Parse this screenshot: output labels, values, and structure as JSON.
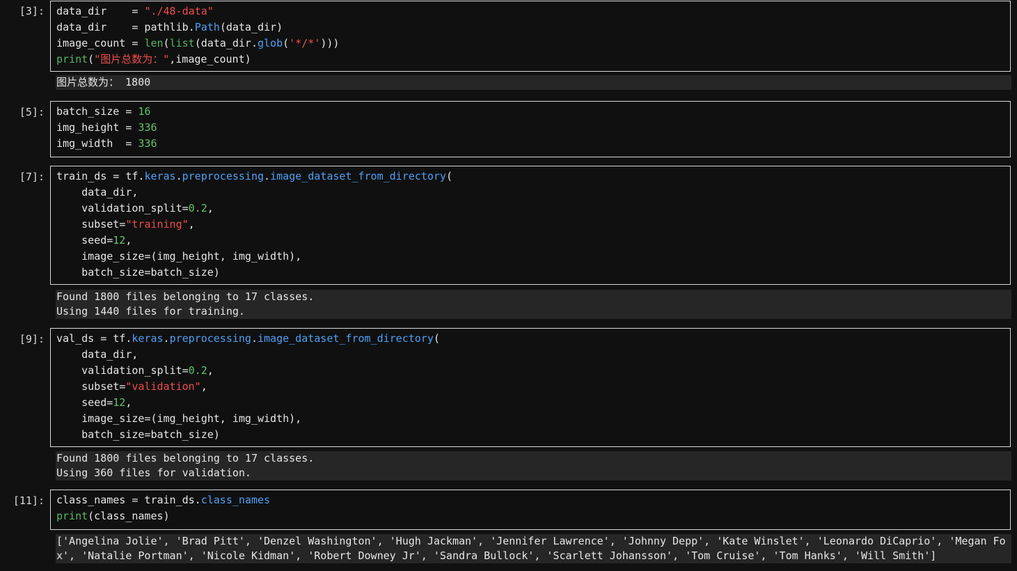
{
  "cells": [
    {
      "prompt": "[3]:",
      "lines": [
        [
          {
            "t": "data_dir    = "
          },
          {
            "t": "\"./48-data\"",
            "c": "str"
          }
        ],
        [
          {
            "t": "data_dir    = pathlib."
          },
          {
            "t": "Path",
            "c": "kw"
          },
          {
            "t": "(data_dir)"
          }
        ],
        [
          {
            "t": "image_count = "
          },
          {
            "t": "len",
            "c": "bi"
          },
          {
            "t": "("
          },
          {
            "t": "list",
            "c": "bi"
          },
          {
            "t": "(data_dir."
          },
          {
            "t": "glob",
            "c": "kw"
          },
          {
            "t": "("
          },
          {
            "t": "'*/*'",
            "c": "str"
          },
          {
            "t": ")))"
          }
        ],
        [
          {
            "t": "print",
            "c": "bi"
          },
          {
            "t": "("
          },
          {
            "t": "\"图片总数为：\"",
            "c": "str"
          },
          {
            "t": ",image_count)"
          }
        ]
      ],
      "output": [
        "图片总数为： 1800"
      ]
    },
    {
      "prompt": "[5]:",
      "lines": [
        [
          {
            "t": "batch_size = "
          },
          {
            "t": "16",
            "c": "num"
          }
        ],
        [
          {
            "t": "img_height = "
          },
          {
            "t": "336",
            "c": "num"
          }
        ],
        [
          {
            "t": "img_width  = "
          },
          {
            "t": "336",
            "c": "num"
          }
        ]
      ],
      "output": []
    },
    {
      "prompt": "[7]:",
      "lines": [
        [
          {
            "t": "train_ds = tf."
          },
          {
            "t": "keras",
            "c": "kw"
          },
          {
            "t": "."
          },
          {
            "t": "preprocessing",
            "c": "kw"
          },
          {
            "t": "."
          },
          {
            "t": "image_dataset_from_directory",
            "c": "kw"
          },
          {
            "t": "("
          }
        ],
        [
          {
            "t": "    data_dir,"
          }
        ],
        [
          {
            "t": "    validation_split="
          },
          {
            "t": "0.2",
            "c": "num"
          },
          {
            "t": ","
          }
        ],
        [
          {
            "t": "    subset="
          },
          {
            "t": "\"training\"",
            "c": "str"
          },
          {
            "t": ","
          }
        ],
        [
          {
            "t": "    seed="
          },
          {
            "t": "12",
            "c": "num"
          },
          {
            "t": ","
          }
        ],
        [
          {
            "t": "    image_size=(img_height, img_width),"
          }
        ],
        [
          {
            "t": "    batch_size=batch_size)"
          }
        ]
      ],
      "output": [
        "Found 1800 files belonging to 17 classes.",
        "Using 1440 files for training."
      ]
    },
    {
      "prompt": "[9]:",
      "lines": [
        [
          {
            "t": "val_ds = tf."
          },
          {
            "t": "keras",
            "c": "kw"
          },
          {
            "t": "."
          },
          {
            "t": "preprocessing",
            "c": "kw"
          },
          {
            "t": "."
          },
          {
            "t": "image_dataset_from_directory",
            "c": "kw"
          },
          {
            "t": "("
          }
        ],
        [
          {
            "t": "    data_dir,"
          }
        ],
        [
          {
            "t": "    validation_split="
          },
          {
            "t": "0.2",
            "c": "num"
          },
          {
            "t": ","
          }
        ],
        [
          {
            "t": "    subset="
          },
          {
            "t": "\"validation\"",
            "c": "str"
          },
          {
            "t": ","
          }
        ],
        [
          {
            "t": "    seed="
          },
          {
            "t": "12",
            "c": "num"
          },
          {
            "t": ","
          }
        ],
        [
          {
            "t": "    image_size=(img_height, img_width),"
          }
        ],
        [
          {
            "t": "    batch_size=batch_size)"
          }
        ]
      ],
      "output": [
        "Found 1800 files belonging to 17 classes.",
        "Using 360 files for validation."
      ]
    },
    {
      "prompt": "[11]:",
      "lines": [
        [
          {
            "t": "class_names = train_ds."
          },
          {
            "t": "class_names",
            "c": "kw"
          }
        ],
        [
          {
            "t": "print",
            "c": "bi"
          },
          {
            "t": "(class_names)"
          }
        ]
      ],
      "output": [
        "['Angelina Jolie', 'Brad Pitt', 'Denzel Washington', 'Hugh Jackman', 'Jennifer Lawrence', 'Johnny Depp', 'Kate Winslet', 'Leonardo DiCaprio', 'Megan Fo",
        "x', 'Natalie Portman', 'Nicole Kidman', 'Robert Downey Jr', 'Sandra Bullock', 'Scarlett Johansson', 'Tom Cruise', 'Tom Hanks', 'Will Smith']"
      ]
    }
  ],
  "colors": {
    "background": "#111111",
    "output_background": "#262626",
    "keyword_blue": "#4fa0f5",
    "builtin_green": "#55b566",
    "number_green": "#62c46d",
    "string_red": "#ef4d4d"
  }
}
